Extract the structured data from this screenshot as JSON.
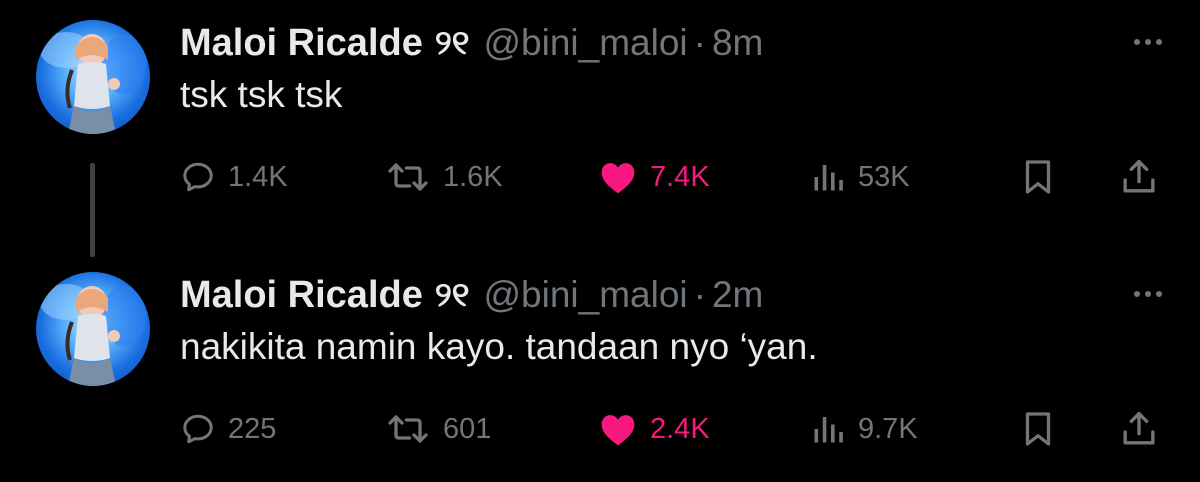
{
  "tweets": [
    {
      "author": {
        "display_name": "Maloi Ricalde",
        "name_glyph": "୨୧",
        "handle": "@bini_maloi"
      },
      "separator": "·",
      "time": "8m",
      "text": "tsk tsk tsk",
      "stats": {
        "replies": "1.4K",
        "reposts": "1.6K",
        "likes": "7.4K",
        "views": "53K"
      },
      "liked": true
    },
    {
      "author": {
        "display_name": "Maloi Ricalde",
        "name_glyph": "୨୧",
        "handle": "@bini_maloi"
      },
      "separator": "·",
      "time": "2m",
      "text": "nakikita namin kayo. tandaan nyo ‘yan.",
      "stats": {
        "replies": "225",
        "reposts": "601",
        "likes": "2.4K",
        "views": "9.7K"
      },
      "liked": true
    }
  ],
  "colors": {
    "background": "#000000",
    "text_primary": "#e7e9ea",
    "text_secondary": "#71767b",
    "like_active": "#f91880",
    "thread_line": "#3e4144"
  },
  "icons": {
    "reply": "reply-bubble-icon",
    "repost": "repost-arrows-icon",
    "like": "heart-filled-icon",
    "views": "views-bar-chart-icon",
    "bookmark": "bookmark-icon",
    "share": "share-upload-icon",
    "more": "more-dots-icon"
  }
}
